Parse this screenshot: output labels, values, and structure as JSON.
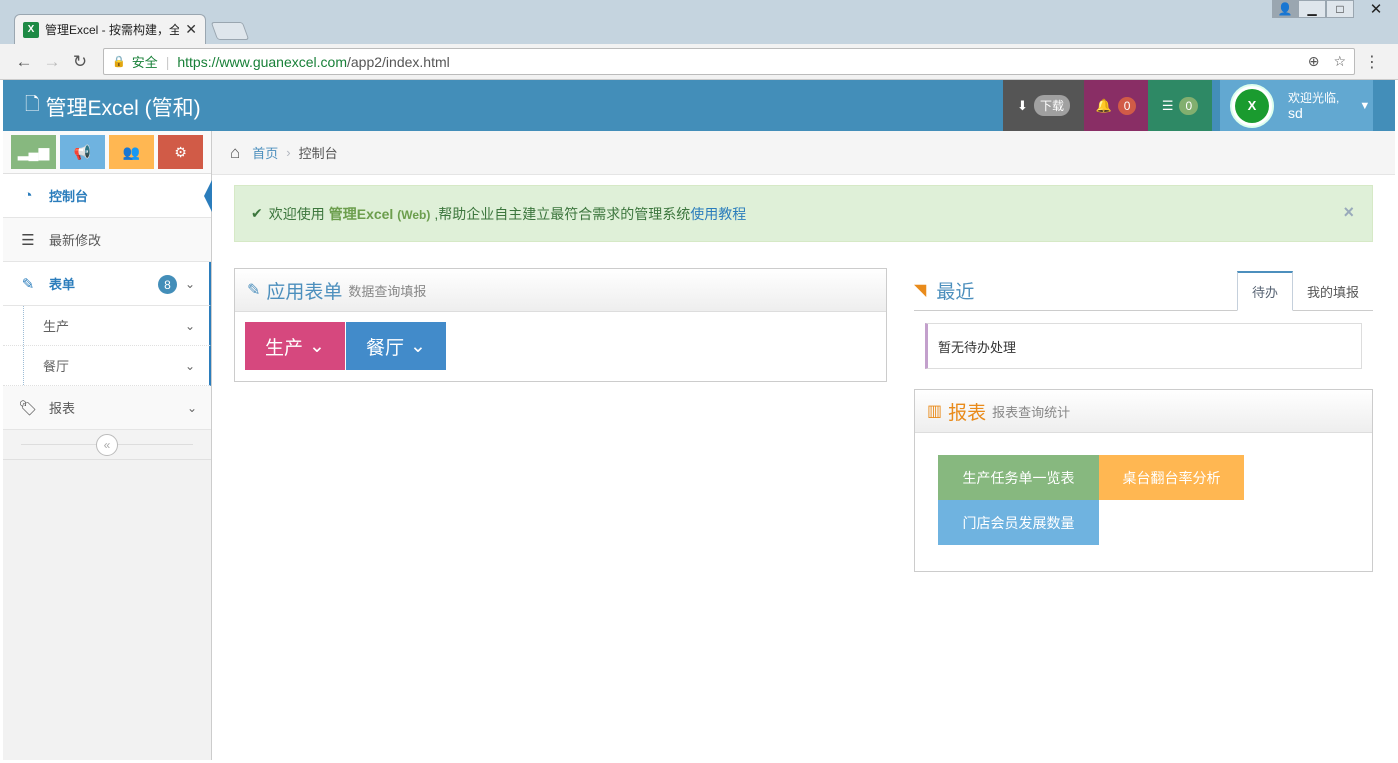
{
  "browser": {
    "tab_title": "管理Excel - 按需构建，全",
    "tab_favicon": "X",
    "secure_label": "安全",
    "url_host": "https://www.guanexcel.com",
    "url_path": "/app2/index.html"
  },
  "header": {
    "brand": "管理Excel (管和)",
    "download_label": "下载",
    "notifications_count": "0",
    "tasks_count": "0",
    "avatar_letter": "X",
    "welcome": "欢迎光临,",
    "username": "sd"
  },
  "sidebar": {
    "items": [
      {
        "label": "控制台"
      },
      {
        "label": "最新修改"
      },
      {
        "label": "表单",
        "badge": "8"
      },
      {
        "label": "生产"
      },
      {
        "label": "餐厅"
      },
      {
        "label": "报表"
      }
    ],
    "collapse_icon": "«"
  },
  "breadcrumb": {
    "home": "首页",
    "current": "控制台"
  },
  "alert": {
    "prefix": "欢迎使用",
    "product": "管理Excel",
    "product_suffix": "(Web)",
    "text": ",帮助企业自主建立最符合需求的管理系统",
    "link": "使用教程",
    "close": "×"
  },
  "apps": {
    "title": "应用表单",
    "subtitle": "数据查询填报",
    "buttons": [
      "生产",
      "餐厅"
    ]
  },
  "recent": {
    "title": "最近",
    "tabs": [
      "待办",
      "我的填报"
    ],
    "empty": "暂无待办处理"
  },
  "reports": {
    "title": "报表",
    "subtitle": "报表查询统计",
    "buttons": [
      "生产任务单一览表",
      "桌台翻台率分析",
      "门店会员发展数量"
    ]
  },
  "colors": {
    "header": "#438eb9",
    "accent": "#2b7dbc",
    "pink": "#d6487e",
    "green": "#87b87f",
    "orange": "#ffb752"
  }
}
